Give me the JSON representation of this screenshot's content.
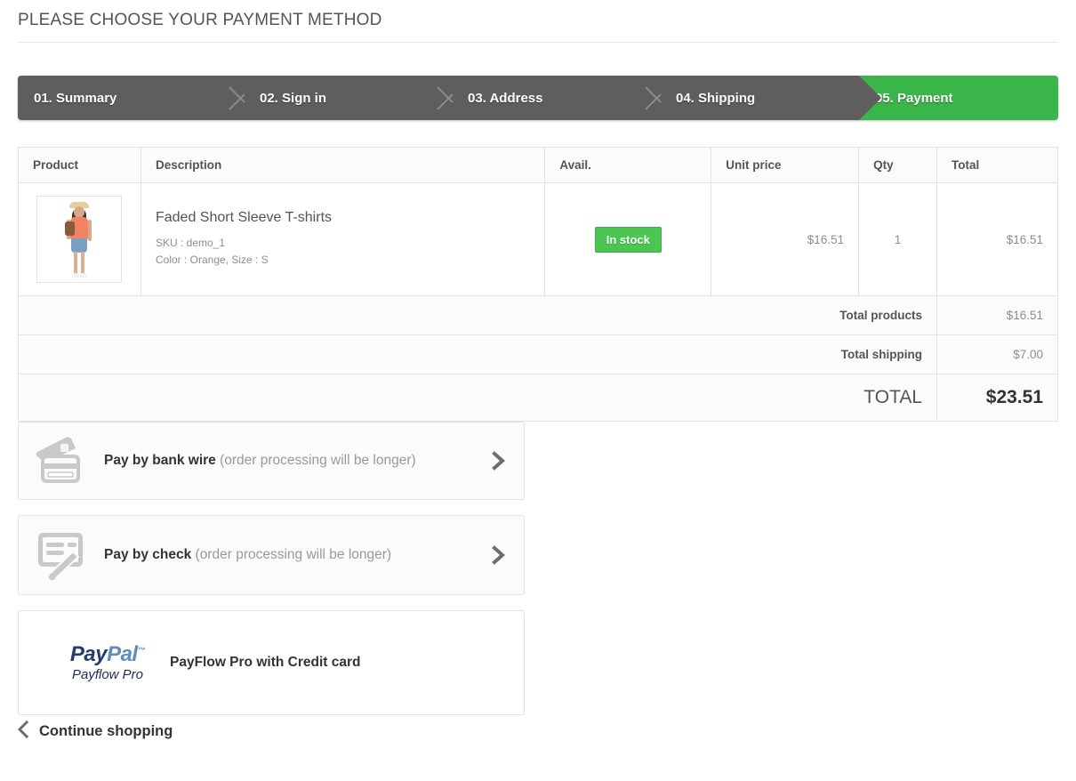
{
  "heading": "PLEASE CHOOSE YOUR PAYMENT METHOD",
  "steps": [
    {
      "label": "01. Summary"
    },
    {
      "label": "02. Sign in"
    },
    {
      "label": "03. Address"
    },
    {
      "label": "04. Shipping"
    },
    {
      "label": "05. Payment"
    }
  ],
  "colors": {
    "step_inactive": "#5f5d5d",
    "step_current": "#3ab54a",
    "stock_badge": "#4cc552",
    "paypal_dark": "#223c6e",
    "paypal_light": "#5f8cbd"
  },
  "cart": {
    "headers": {
      "product": "Product",
      "description": "Description",
      "avail": "Avail.",
      "unit_price": "Unit price",
      "qty": "Qty",
      "total": "Total"
    },
    "item": {
      "name": "Faded Short Sleeve T-shirts",
      "sku": "SKU : demo_1",
      "attributes": "Color : Orange, Size : S",
      "availability": "In stock",
      "unit_price": "$16.51",
      "qty": "1",
      "line_total": "$16.51"
    },
    "totals": [
      {
        "label": "Total products",
        "value": "$16.51"
      },
      {
        "label": "Total shipping",
        "value": "$7.00"
      }
    ],
    "grand_total": {
      "label": "TOTAL",
      "value": "$23.51"
    }
  },
  "payment_methods": [
    {
      "id": "bankwire",
      "title": "Pay by bank wire",
      "note": "(order processing will be longer)",
      "icon": "credit-cards-icon"
    },
    {
      "id": "check",
      "title": "Pay by check",
      "note": "(order processing will be longer)",
      "icon": "cheque-pen-icon"
    },
    {
      "id": "payflowpro",
      "logo_top_primary": "Pay",
      "logo_top_secondary": "Pal",
      "logo_trademark": "™",
      "logo_sub": "Payflow Pro",
      "title": "PayFlow Pro with Credit card"
    }
  ],
  "continue_shopping": "Continue shopping"
}
